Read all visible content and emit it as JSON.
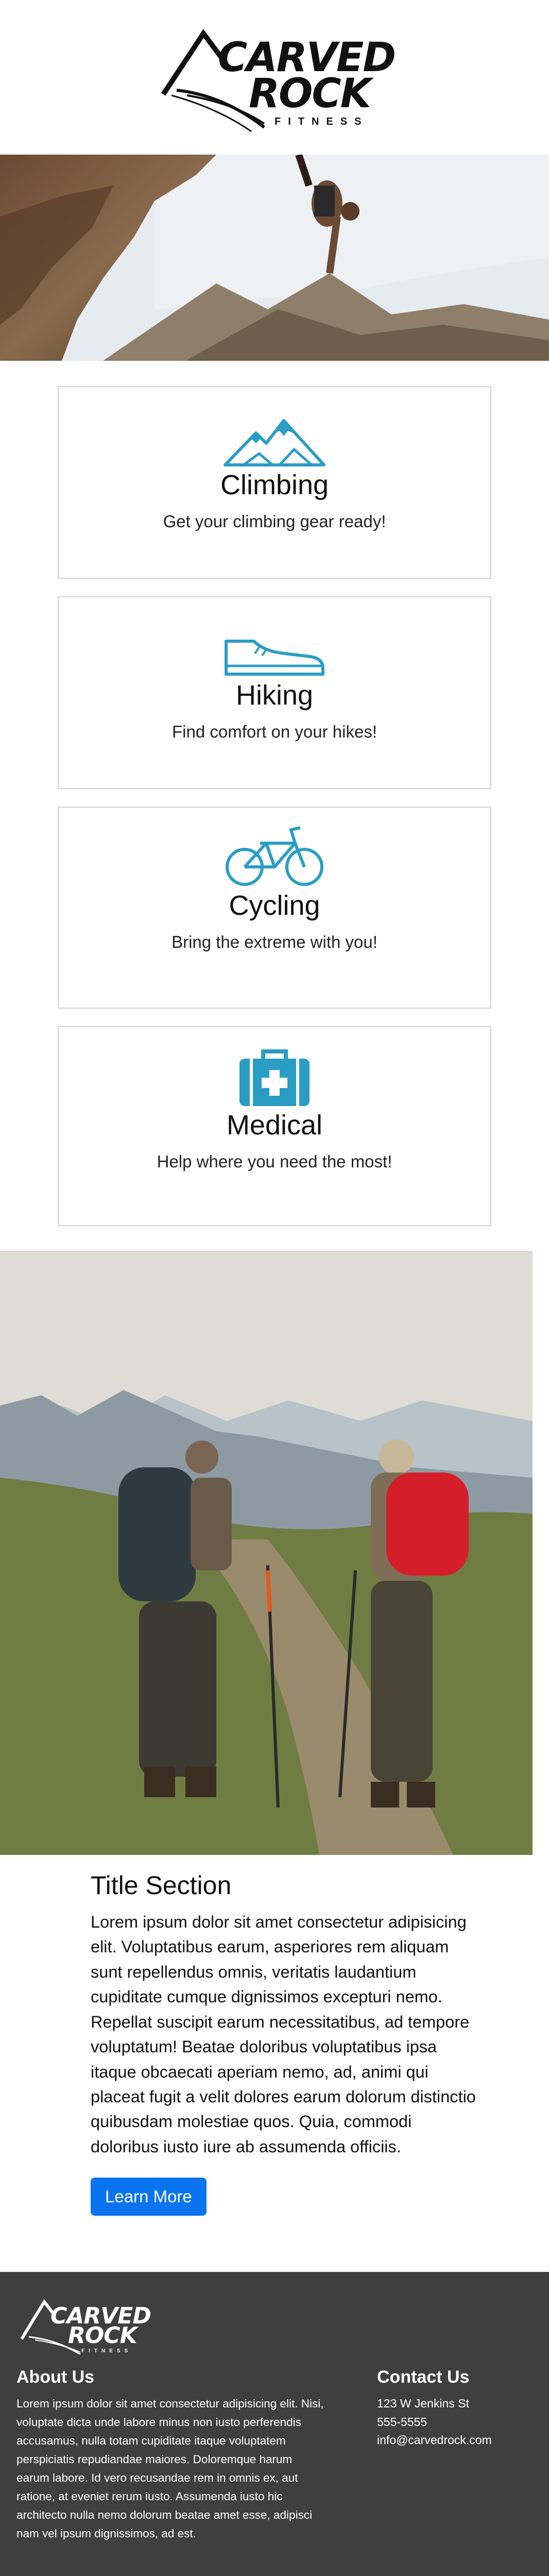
{
  "logo": {
    "word1": "CARVED",
    "word2": "ROCK",
    "tagline": "FITNESS"
  },
  "hero": {
    "alt": "Rock climber on a cliff over mountains"
  },
  "cards": [
    {
      "icon": "mountains-icon",
      "title": "Climbing",
      "description": "Get your climbing gear ready!"
    },
    {
      "icon": "shoe-icon",
      "title": "Hiking",
      "description": "Find comfort on your hikes!"
    },
    {
      "icon": "bicycle-icon",
      "title": "Cycling",
      "description": "Bring the extreme with you!"
    },
    {
      "icon": "medical-kit-icon",
      "title": "Medical",
      "description": "Help where you need the most!"
    }
  ],
  "hikers": {
    "alt": "Two hikers with backpacks in mountains"
  },
  "section": {
    "title": "Title Section",
    "body": "Lorem ipsum dolor sit amet consectetur adipisicing elit. Voluptatibus earum, asperiores rem aliquam sunt repellendus omnis, veritatis laudantium cupiditate cumque dignissimos excepturi nemo. Repellat suscipit earum necessitatibus, ad tempore voluptatum! Beatae doloribus voluptatibus ipsa itaque obcaecati aperiam nemo, ad, animi qui placeat fugit a velit dolores earum dolorum distinctio quibusdam molestiae quos. Quia, commodi doloribus iusto iure ab assumenda officiis.",
    "button": "Learn More"
  },
  "footer": {
    "about_title": "About Us",
    "about_text": "Lorem ipsum dolor sit amet consectetur adipisicing elit. Nisi, voluptate dicta unde labore minus non iusto perferendis accusamus, nulla totam cupiditate itaque voluptatem perspiciatis repudiandae maiores. Doloremque harum earum labore. Id vero recusandae rem in omnis ex, aut ratione, at eveniet rerum iusto. Assumenda iusto hic architecto nulla nemo dolorum beatae amet esse, adipisci nam vel ipsum dignissimos, ad est.",
    "contact_title": "Contact Us",
    "address": "123 W Jenkins St",
    "phone": "555-5555",
    "email": "info@carvedrock.com"
  },
  "colors": {
    "accent_icon": "#2a9dc4",
    "button_blue": "#0a74f0",
    "footer_bg": "#3f3f3f"
  }
}
